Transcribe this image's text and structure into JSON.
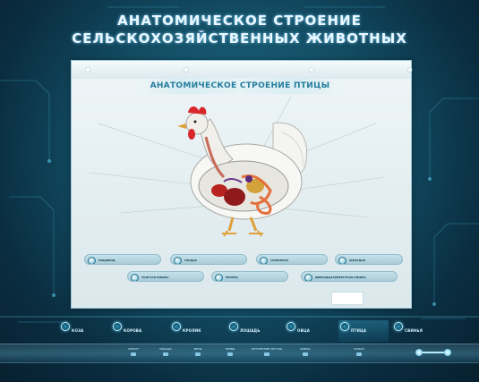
{
  "header": {
    "title_line1": "АНАТОМИЧЕСКОЕ СТРОЕНИЕ",
    "title_line2": "СЕЛЬСКОХОЗЯЙСТВЕННЫХ ЖИВОТНЫХ"
  },
  "panel": {
    "title": "АНАТОМИЧЕСКОЕ СТРОЕНИЕ ПТИЦЫ",
    "labels": [
      "ПИЩЕВОД",
      "СЕРДЦЕ",
      "СЕЛЕЗЕНКА",
      "ЖЕЛУДОК",
      "ТОЛСТАЯ КИШКА",
      "ПЕЧЕНЬ",
      "ДВЕНАДЦАТИПЕРСТНАЯ КИШКА"
    ]
  },
  "nav": {
    "items": [
      "КОЗА",
      "КОРОВА",
      "КРОЛИК",
      "ЛОШАДЬ",
      "ОВЦА",
      "ПТИЦА",
      "СВИНЬЯ"
    ],
    "active": "ПТИЦА"
  },
  "toolbar": {
    "items": [
      "СКЕЛЕТ",
      "МЫШЦЫ",
      "ВЕНЫ",
      "НЕРВЫ",
      "ВНУТРЕННИЕ ОРГАНЫ",
      "ЛИМФА",
      "СКРЫТЬ"
    ]
  },
  "colors": {
    "background": "#124b62",
    "panel": "#e6f0f3",
    "accent": "#247d9c"
  }
}
